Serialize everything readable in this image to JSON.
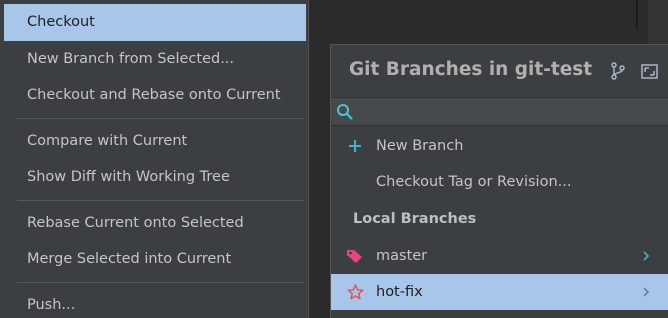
{
  "context_menu": {
    "groups": [
      [
        "Checkout",
        "New Branch from Selected...",
        "Checkout and Rebase onto Current"
      ],
      [
        "Compare with Current",
        "Show Diff with Working Tree"
      ],
      [
        "Rebase Current onto Selected",
        "Merge Selected into Current"
      ],
      [
        "Push..."
      ]
    ],
    "selected": "Checkout"
  },
  "git_popup": {
    "title": "Git Branches in git-test",
    "search": {
      "value": "",
      "placeholder": ""
    },
    "actions": [
      {
        "label": "New Branch",
        "icon": "plus-icon"
      },
      {
        "label": "Checkout Tag or Revision...",
        "icon": ""
      }
    ],
    "local_branches_header": "Local Branches",
    "local_branches": [
      {
        "name": "master",
        "icon": "tag-icon",
        "selected": false
      },
      {
        "name": "hot-fix",
        "icon": "star-icon",
        "selected": true
      }
    ]
  },
  "colors": {
    "menu_bg": "#3c3f41",
    "selection": "#a8c6ea",
    "plus_accent": "#3fb4c4",
    "tag_accent": "#e8457c",
    "star_accent": "#e05050"
  }
}
